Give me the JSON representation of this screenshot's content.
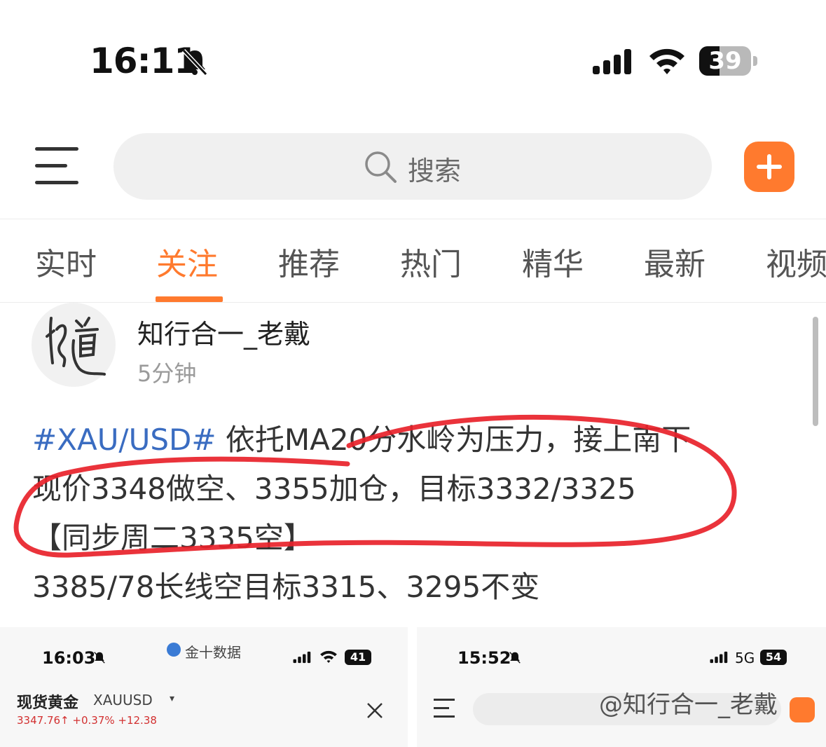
{
  "status_bar": {
    "time": "16:11",
    "battery": "39",
    "battery_level": 0.39
  },
  "header": {
    "search_placeholder": "搜索",
    "menu_icon": "hamburger-menu-icon",
    "add_icon": "plus-icon"
  },
  "tabs": [
    {
      "label": "实时"
    },
    {
      "label": "关注",
      "active": true
    },
    {
      "label": "推荐"
    },
    {
      "label": "热门"
    },
    {
      "label": "精华"
    },
    {
      "label": "最新"
    },
    {
      "label": "视频"
    }
  ],
  "post": {
    "author": "知行合一_老戴",
    "time": "5分钟",
    "hashtag": "#XAU/USD#",
    "line1_text": " 依托MA20分水岭为压力，接上南下",
    "line2": "现价3348做空、3355加仓，目标3332/3325",
    "line3": "【同步周二3335空】",
    "line4": "3385/78长线空目标3315、3295不变"
  },
  "thumb_left": {
    "time": "16:03",
    "app_name": "金十数据",
    "battery": "41",
    "title": "现货黄金",
    "symbol": "XAUUSD",
    "price": "3347.76",
    "change_pct": "+0.37%",
    "change_abs": "+12.38"
  },
  "thumb_right": {
    "time": "15:52",
    "network": "5G",
    "battery": "54"
  },
  "watermark": "@知行合一_老戴",
  "colors": {
    "accent": "#ff7a2e",
    "hashtag": "#3a6cc1",
    "annotation": "#e8222a"
  }
}
